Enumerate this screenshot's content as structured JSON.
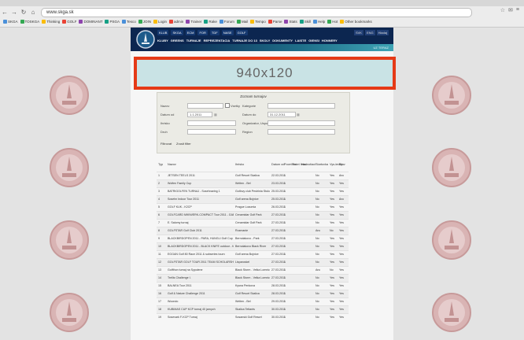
{
  "browser": {
    "url": "www.skga.sk",
    "bookmarks": [
      "SKGA",
      "TOSKGA",
      "Thinking",
      "GOLF",
      "DOMINANT",
      "PSGA",
      "Tesco",
      "JOIN",
      "Login",
      "admin",
      "Trainer",
      "Rake",
      "Forum",
      "Mail",
      "Tempo",
      "Parse",
      "Stats",
      "Skill",
      "Help",
      "Hot",
      "Other bookmarks"
    ]
  },
  "site": {
    "nav_top": [
      "KLUB",
      "SKGA",
      "ECM",
      "FOR",
      "TDF",
      "NASE",
      "GOLF"
    ],
    "languages": [
      "SVK",
      "ENG",
      "Hladaj"
    ],
    "menu": [
      "KLUBY",
      "GREENS",
      "TURNAJE",
      "REPREZENTACIA",
      "TURNAJE DO 13",
      "SKOLY",
      "DOKUMENTY",
      "LAISTE",
      "GIENSI",
      "HONNERY"
    ],
    "strip_text": "UZ TERAZ"
  },
  "banner": {
    "text": "940x120"
  },
  "filter": {
    "title": "Zoznam turnajov",
    "labels": {
      "nazov": "Nazov",
      "kategoria": "Kategorie",
      "datum_od": "Datum od",
      "datum_do": "Datum do",
      "ihrisko": "Ihrisko",
      "organizator": "Organizator, Usporiadatel",
      "druh": "Druh",
      "region": "Region",
      "checkbox": "Vsetky"
    },
    "values": {
      "datum_od": "1.1.2011",
      "datum_do": "31.12.2011"
    },
    "buttons": {
      "filter": "Filtrovat",
      "reset": "Zrusit filter"
    }
  },
  "table": {
    "columns": [
      "Typ",
      "Nazov",
      "Ihrisko",
      "Datum od",
      "Pocet dni",
      "Pocet hrac.",
      "Hodnotiaci",
      "Startovka",
      "Vys-ledky",
      "Stav"
    ],
    "rows": [
      [
        "1",
        "JETSEN TEELS 2011",
        "Golf Resort Skalica",
        "22.03.2011",
        "1",
        "",
        "No",
        "Yes",
        "Ano"
      ],
      [
        "2",
        "Wolfen Family Cup",
        "Welten - Bel",
        "23.03.2011",
        "1",
        "",
        "No",
        "Yes",
        "Yes"
      ],
      [
        "3",
        "BATRIGOLFEN TURNAJ - Sosehnaring 1",
        "Golfovy club Pestrinia Stukova",
        "25.03.2011",
        "1",
        "",
        "No",
        "Yes",
        "Yes"
      ],
      [
        "4",
        "Sosehn Indoor Tour 2011",
        "Golf arena Bojnice",
        "25.03.2011",
        "1",
        "",
        "No",
        "Yes",
        "Ano"
      ],
      [
        "5",
        "GOLF KUK - K2CP",
        "Prague Lozumia",
        "26.03.2011",
        "1",
        "",
        "No",
        "Yes",
        "Yes"
      ],
      [
        "6",
        "GOLFCARD MIKIWERK-COMPACT Tour 2011 - GABUPHEL outside",
        "Cenamidar Golf Park",
        "27.03.2011",
        "1",
        "",
        "No",
        "Yes",
        "Yes"
      ],
      [
        "7",
        "E. Salomy turnaj",
        "Cenamidar Golf Park",
        "27.03.2011",
        "1",
        "",
        "No",
        "Yes",
        "Yes"
      ],
      [
        "8",
        "GOLFSTAR Golf Club 2011",
        "Rozmanie",
        "27.03.2011",
        "1",
        "",
        "Ano",
        "No",
        "Yes"
      ],
      [
        "9",
        "BLACKBIRDOPEN 2011 - PARA, HUNGLI Golf Cup 2011",
        "Bernolakovo - Park",
        "27.03.2011",
        "1",
        "",
        "No",
        "Yes",
        "Yes"
      ],
      [
        "10",
        "BLACKBIRDOPEN 2011 - BLACK KNIFE outdoor - forum x line",
        "Bernolakovo Black River",
        "27.03.2011",
        "1",
        "",
        "No",
        "Yes",
        "Yes"
      ],
      [
        "11",
        "EGGAN Golf 80 Race 2011 & subseries tourn",
        "Golf arena Bojnice",
        "27.03.2011",
        "1",
        "",
        "No",
        "Yes",
        "Yes"
      ],
      [
        "12",
        "GOLFSTAR GOLF TOUR 2011 TEAM SCHOLARSHIP",
        "Lisparoskel",
        "27.03.2011",
        "1",
        "",
        "No",
        "Yes",
        "Yes"
      ],
      [
        "13",
        "Golfthon turnaj na Sypolene",
        "Black Storm - Velka Lomnica",
        "27.03.2011",
        "1",
        "",
        "Ano",
        "No",
        "Yes"
      ],
      [
        "14",
        "Trellis Challenge I.",
        "Black Storm - Velka Lomnica",
        "27.03.2011",
        "1",
        "",
        "No",
        "Yes",
        "Yes"
      ],
      [
        "15",
        "BALNEA Tour 2011",
        "Kysna Penkova",
        "28.03.2011",
        "1",
        "",
        "No",
        "Yes",
        "Yes"
      ],
      [
        "16",
        "Golf & Nature Challenge 2011",
        "Golf Resort Skalica",
        "28.03.2011",
        "1",
        "",
        "No",
        "Yes",
        "Yes"
      ],
      [
        "17",
        "Woondo",
        "Welten - Bel",
        "29.03.2011",
        "1",
        "",
        "No",
        "Yes",
        "Yes"
      ],
      [
        "18",
        "KUBIMAS CUP KCP turnaj 40 jarnych",
        "Skalica Tetlants",
        "30.03.2011",
        "1",
        "",
        "No",
        "Yes",
        "Yes"
      ],
      [
        "19",
        "Sosevark F-KCP Turnaj",
        "Sosanski Golf Resort",
        "30.03.2011",
        "1",
        "",
        "No",
        "Yes",
        "Yes"
      ]
    ]
  },
  "colors": {
    "banner_border": "#e53a17",
    "banner_bg": "#c9e3e5",
    "header_bg": "#0c2650"
  }
}
